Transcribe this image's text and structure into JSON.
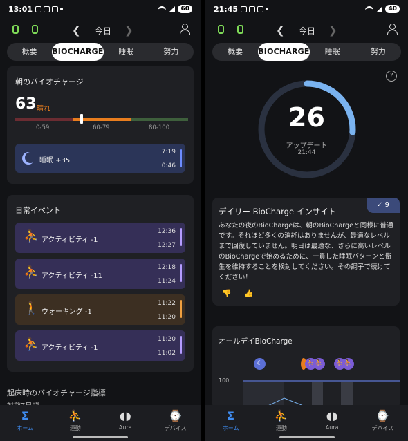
{
  "left": {
    "status": {
      "time": "13:01",
      "battery": "60"
    },
    "header": {
      "date": "今日"
    },
    "tabs": [
      "概要",
      "BIOCHARGE",
      "睡眠",
      "努力"
    ],
    "morning_card": {
      "title": "朝のバイオチャージ",
      "value": "63",
      "grade": "晴れ",
      "range_labels": [
        "0-59",
        "60-79",
        "80-100"
      ],
      "range_colors": [
        "#6b2c32",
        "#e87d1e",
        "#3e5f3c"
      ],
      "sleep": {
        "label": "睡眠 +35",
        "time_top": "7:19",
        "time_bottom": "0:46",
        "color": "#6d8cff"
      }
    },
    "events_card": {
      "title": "日常イベント",
      "events": [
        {
          "label": "アクティビティ -1",
          "time_top": "12:36",
          "time_bottom": "12:27",
          "kind": "activity",
          "icon": "activity-icon"
        },
        {
          "label": "アクティビティ -11",
          "time_top": "12:18",
          "time_bottom": "11:24",
          "kind": "activity",
          "icon": "activity-icon"
        },
        {
          "label": "ウォーキング -1",
          "time_top": "11:22",
          "time_bottom": "11:20",
          "kind": "walk",
          "icon": "walking-icon"
        },
        {
          "label": "アクティビティ -1",
          "time_top": "11:20",
          "time_bottom": "11:02",
          "kind": "activity",
          "icon": "activity-icon"
        }
      ]
    },
    "footer": {
      "title": "起床時のバイオチャージ指標",
      "subtitle": "対前7日間"
    }
  },
  "right": {
    "status": {
      "time": "21:45",
      "battery": "40"
    },
    "header": {
      "date": "今日"
    },
    "tabs": [
      "概要",
      "BIOCHARGE",
      "睡眠",
      "努力"
    ],
    "ring": {
      "value": "26",
      "label": "アップデート",
      "time": "21:44",
      "fraction": 0.26
    },
    "insight": {
      "title": "デイリー BioCharge インサイト",
      "badge": "9",
      "body": "あなたの夜のBioChargeは、朝のBioChargeと同様に普通です。それほど多くの消耗はありませんが、最適なレベルまで回復していません。明日は最適な、さらに高いレベルのBioChargeで始めるために、一貫した睡眠パターンと衛生を維持することを検討してください。その調子で続けてください！"
    },
    "allday": {
      "title": "オールデイBioCharge",
      "y_label": "100"
    }
  },
  "nav": [
    {
      "label": "ホーム",
      "icon": "home-icon",
      "glyph": "Σ"
    },
    {
      "label": "運動",
      "icon": "workout-icon",
      "glyph": "⛹"
    },
    {
      "label": "Aura",
      "icon": "aura-icon",
      "glyph": "◖◗"
    },
    {
      "label": "デバイス",
      "icon": "device-icon",
      "glyph": "⌚"
    }
  ],
  "colors": {
    "accent": "#3f8cf0",
    "ring": "#7ab3f0",
    "activity": "#b59cff",
    "walk": "#f0a040"
  }
}
